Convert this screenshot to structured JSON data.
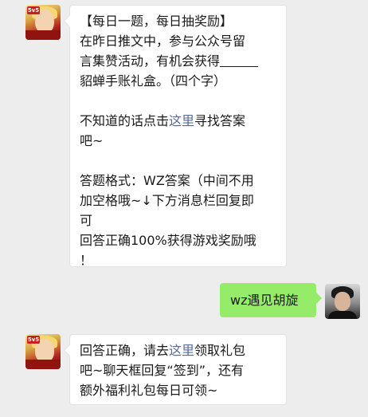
{
  "messages": [
    {
      "sender": "game-account",
      "lines": [
        {
          "text": "【每日一题，每日抽奖励】"
        },
        {
          "text": "在昨日推文中，参与公众号留"
        },
        {
          "pre": "言集赞活动，有机会获得",
          "blank": true
        },
        {
          "text": "貂蝉手账礼盒。（四个字）"
        },
        {
          "text": ""
        },
        {
          "pre": "不知道的话点击",
          "link": "这里",
          "post": "寻找答案"
        },
        {
          "text": "吧~"
        },
        {
          "text": ""
        },
        {
          "text": "答题格式：WZ答案（中间不用"
        },
        {
          "text": "加空格哦~↓下方消息栏回复即"
        },
        {
          "text": "可"
        },
        {
          "text": "回答正确100%获得游戏奖励哦"
        },
        {
          "text": "！"
        }
      ]
    },
    {
      "sender": "user",
      "text": "wz遇见胡旋"
    },
    {
      "sender": "game-account",
      "lines": [
        {
          "pre": "回答正确，请去",
          "link": "这里",
          "post": "领取礼包"
        },
        {
          "text": "吧~聊天框回复“签到”，还有"
        },
        {
          "text": "额外福利礼包每日可领~"
        }
      ]
    }
  ],
  "avatar_badge": "5v5",
  "colors": {
    "background": "#ededed",
    "left_bubble": "#ffffff",
    "right_bubble": "#95ec69",
    "link": "#576b95"
  }
}
